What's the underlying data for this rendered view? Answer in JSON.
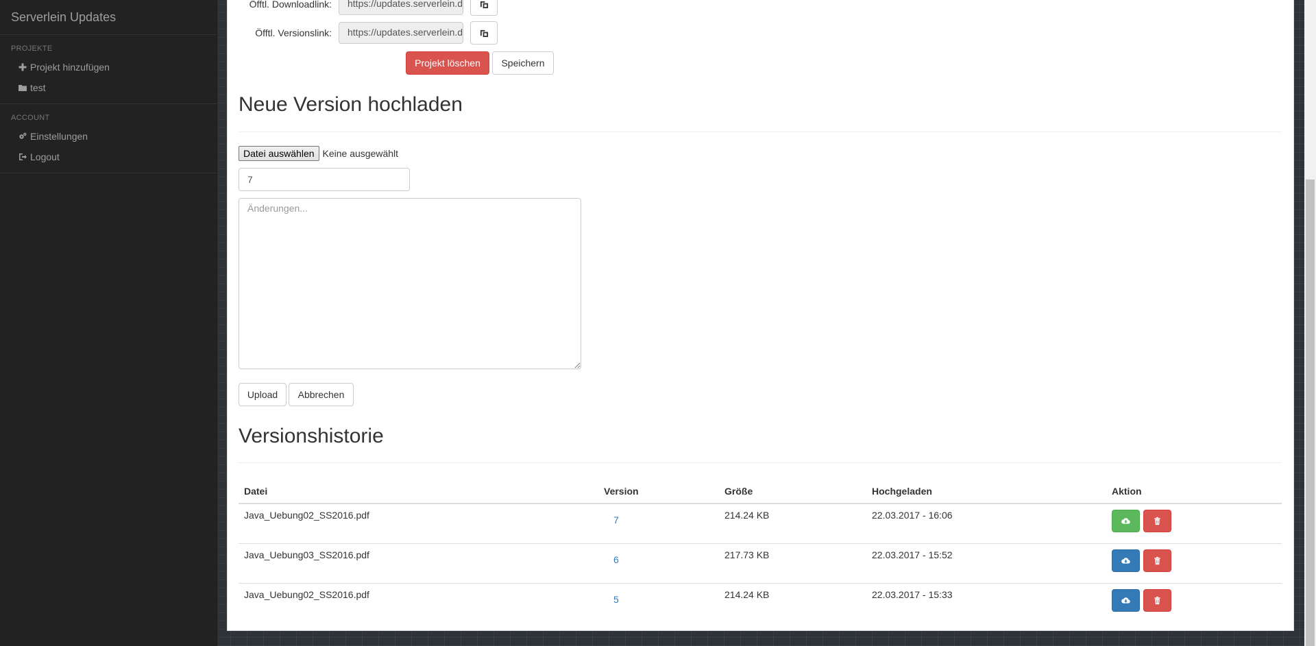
{
  "sidebar": {
    "brand": "Serverlein Updates",
    "sections": [
      {
        "header": "PROJEKTE",
        "items": [
          {
            "icon": "plus-icon",
            "label": "Projekt hinzufügen"
          },
          {
            "icon": "folder-icon",
            "label": "test"
          }
        ]
      },
      {
        "header": "ACCOUNT",
        "items": [
          {
            "icon": "gears-icon",
            "label": "Einstellungen"
          },
          {
            "icon": "logout-icon",
            "label": "Logout"
          }
        ]
      }
    ]
  },
  "project_form": {
    "download_link_label": "Öfftl. Downloadlink:",
    "download_link_value": "https://updates.serverlein.de/download",
    "version_link_label": "Öfftl. Versionslink:",
    "version_link_value": "https://updates.serverlein.de/download",
    "delete_label": "Projekt löschen",
    "save_label": "Speichern"
  },
  "upload": {
    "heading": "Neue Version hochladen",
    "file_button": "Datei auswählen",
    "file_status": "Keine ausgewählt",
    "version_value": "7",
    "changes_placeholder": "Änderungen...",
    "upload_label": "Upload",
    "cancel_label": "Abbrechen"
  },
  "history": {
    "heading": "Versionshistorie",
    "columns": [
      "Datei",
      "Version",
      "Größe",
      "Hochgeladen",
      "Aktion"
    ],
    "rows": [
      {
        "file": "Java_Uebung02_SS2016.pdf",
        "version": "7",
        "size": "214.24 KB",
        "uploaded": "22.03.2017 - 16:06",
        "current": true
      },
      {
        "file": "Java_Uebung03_SS2016.pdf",
        "version": "6",
        "size": "217.73 KB",
        "uploaded": "22.03.2017 - 15:52",
        "current": false
      },
      {
        "file": "Java_Uebung02_SS2016.pdf",
        "version": "5",
        "size": "214.24 KB",
        "uploaded": "22.03.2017 - 15:33",
        "current": false
      }
    ]
  },
  "colors": {
    "danger": "#d9534f",
    "success": "#5cb85c",
    "primary": "#337ab7",
    "sidebar_bg": "#222222"
  }
}
